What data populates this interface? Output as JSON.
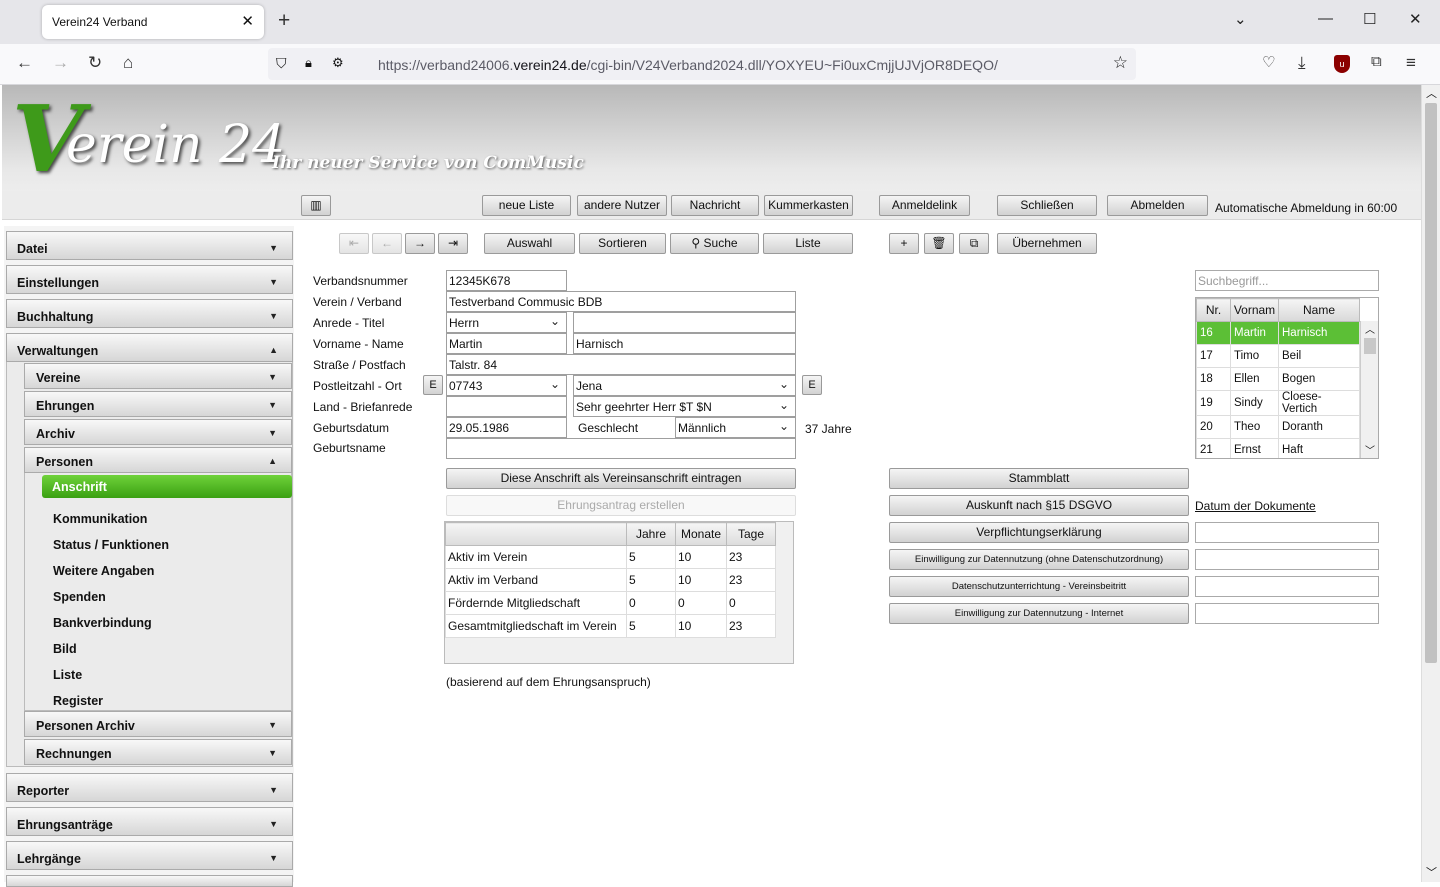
{
  "browser": {
    "tab_title": "Verein24 Verband",
    "url_pre": "https://verband24006.",
    "url_host": "verein24.de",
    "url_post": "/cgi-bin/V24Verband2024.dll/YOXYEU~Fi0uxCmjjUJVjOR8DEQO/"
  },
  "header": {
    "logo_v": "V",
    "logo_rest": "erein 24",
    "slogan": "Ihr neuer Service von ComMusic"
  },
  "toolbar": {
    "neue_liste": "neue Liste",
    "andere_nutzer": "andere Nutzer",
    "nachricht": "Nachricht",
    "kummerkasten": "Kummerkasten",
    "anmeldelink": "Anmeldelink",
    "schliessen": "Schließen",
    "abmelden": "Abmelden",
    "auto_logout": "Automatische Abmeldung in 60:00"
  },
  "actions": {
    "auswahl": "Auswahl",
    "sortieren": "Sortieren",
    "suche": "Suche",
    "liste": "Liste",
    "uebernehmen": "Übernehmen"
  },
  "menu": {
    "datei": "Datei",
    "einstellungen": "Einstellungen",
    "buchhaltung": "Buchhaltung",
    "verwaltungen": "Verwaltungen",
    "vereine": "Vereine",
    "ehrungen": "Ehrungen",
    "archiv": "Archiv",
    "personen": "Personen",
    "anschrift": "Anschrift",
    "kommunikation": "Kommunikation",
    "status": "Status / Funktionen",
    "weitere": "Weitere Angaben",
    "spenden": "Spenden",
    "bank": "Bankverbindung",
    "bild": "Bild",
    "liste": "Liste",
    "register": "Register",
    "personen_archiv": "Personen Archiv",
    "rechnungen": "Rechnungen",
    "reporter": "Reporter",
    "ehrungsantraege": "Ehrungsanträge",
    "lehrgaenge": "Lehrgänge"
  },
  "form": {
    "labels": {
      "verbandsnummer": "Verbandsnummer",
      "verein": "Verein / Verband",
      "anrede": "Anrede - Titel",
      "vorname": "Vorname - Name",
      "strasse": "Straße / Postfach",
      "plz": "Postleitzahl - Ort",
      "land": "Land - Briefanrede",
      "geburtsdatum": "Geburtsdatum",
      "geburtsname": "Geburtsname",
      "geschlecht": "Geschlecht"
    },
    "values": {
      "verbandsnummer": "12345K678",
      "verein": "Testverband Commusic BDB",
      "anrede": "Herrn",
      "titel": "",
      "vorname": "Martin",
      "name": "Harnisch",
      "strasse": "Talstr. 84",
      "plz": "07743",
      "ort": "Jena",
      "land": "",
      "briefanrede": "Sehr geehrter Herr $T $N",
      "geburtsdatum": "29.05.1986",
      "geschlecht": "Männlich",
      "alter": "37 Jahre",
      "geburtsname": ""
    },
    "e_button": "E",
    "vereinsanschrift_btn": "Diese Anschrift als Vereinsanschrift eintragen",
    "ehrungsantrag_btn": "Ehrungsantrag erstellen",
    "hint": "(basierend auf dem Ehrungsanspruch)"
  },
  "membership": {
    "headers": [
      "",
      "Jahre",
      "Monate",
      "Tage"
    ],
    "rows": [
      [
        "Aktiv im Verein",
        "5",
        "10",
        "23"
      ],
      [
        "Aktiv im Verband",
        "5",
        "10",
        "23"
      ],
      [
        "Fördernde Mitgliedschaft",
        "0",
        "0",
        "0"
      ],
      [
        "Gesamtmitgliedschaft im Verein",
        "5",
        "10",
        "23"
      ]
    ]
  },
  "docs": {
    "stammblatt": "Stammblatt",
    "auskunft": "Auskunft nach §15 DSGVO",
    "datum_link": "Datum der Dokumente",
    "verpflichtung": "Verpflichtungserklärung",
    "einwilligung1": "Einwilligung zur Datennutzung (ohne Datenschutzordnung)",
    "datenschutz": "Datenschutzunterrichtung - Vereinsbeitritt",
    "einwilligung2": "Einwilligung zur Datennutzung - Internet"
  },
  "people": {
    "search_placeholder": "Suchbegriff...",
    "headers": [
      "Nr.",
      "Vornam",
      "Name"
    ],
    "rows": [
      [
        "16",
        "Martin",
        "Harnisch"
      ],
      [
        "17",
        "Timo",
        "Beil"
      ],
      [
        "18",
        "Ellen",
        "Bogen"
      ],
      [
        "19",
        "Sindy",
        "Cloese-Vertich"
      ],
      [
        "20",
        "Theo",
        "Doranth"
      ],
      [
        "21",
        "Ernst",
        "Haft"
      ]
    ]
  },
  "colors": {
    "accent": "#3aa012",
    "selected_row": "#5cbf36"
  }
}
